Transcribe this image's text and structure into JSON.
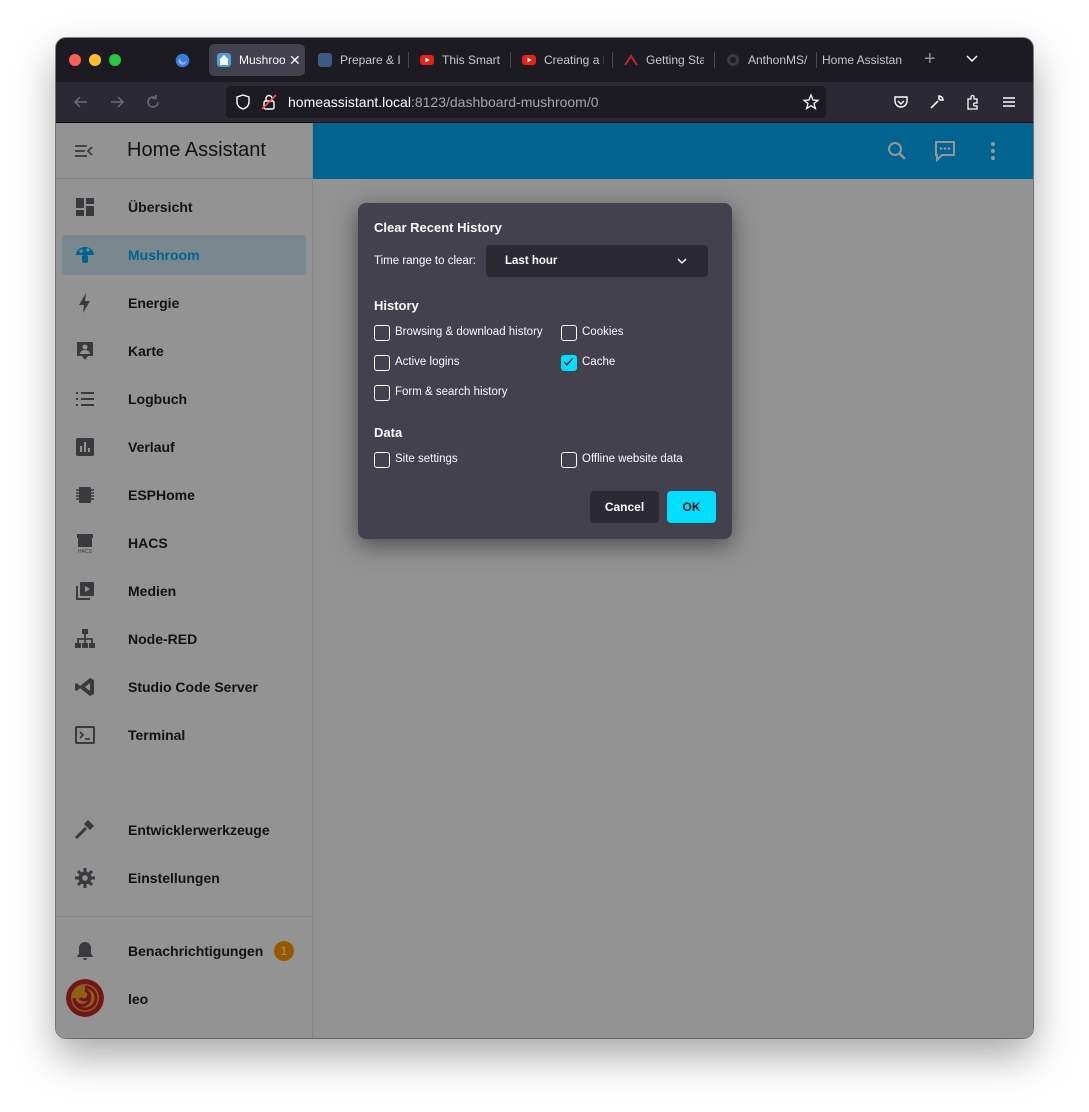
{
  "browser": {
    "tabs": [
      {
        "label": "Mushroo",
        "active": true,
        "favicon": "home-assistant-icon",
        "color": "#49a1d8"
      },
      {
        "label": "Prepare & I",
        "active": false,
        "favicon": "blue-square-icon",
        "color": "#3b5b85"
      },
      {
        "label": "This Smart",
        "active": false,
        "favicon": "youtube-icon",
        "color": "#e62117"
      },
      {
        "label": "Creating a I",
        "active": false,
        "favicon": "youtube-icon",
        "color": "#e62117"
      },
      {
        "label": "Getting Sta",
        "active": false,
        "favicon": "red-logo-icon",
        "color": "#c0262e"
      },
      {
        "label": "AnthonMS/",
        "active": false,
        "favicon": "github-icon",
        "color": "#3a3a3a"
      },
      {
        "label": "Home Assistan",
        "active": false,
        "favicon": "",
        "color": ""
      }
    ],
    "url": {
      "host": "homeassistant.local",
      "rest": ":8123/dashboard-mushroom/0"
    }
  },
  "app": {
    "title": "Home Assistant",
    "accent": "#03a9f4",
    "sidebar": {
      "items": [
        {
          "label": "Übersicht",
          "icon": "dashboard-icon"
        },
        {
          "label": "Mushroom",
          "icon": "mushroom-icon",
          "selected": true
        },
        {
          "label": "Energie",
          "icon": "lightning-icon"
        },
        {
          "label": "Karte",
          "icon": "map-person-icon"
        },
        {
          "label": "Logbuch",
          "icon": "list-icon"
        },
        {
          "label": "Verlauf",
          "icon": "chart-icon"
        },
        {
          "label": "ESPHome",
          "icon": "chip-icon"
        },
        {
          "label": "HACS",
          "icon": "hacs-icon"
        },
        {
          "label": "Medien",
          "icon": "media-icon"
        },
        {
          "label": "Node-RED",
          "icon": "sitemap-icon"
        },
        {
          "label": "Studio Code Server",
          "icon": "vscode-icon"
        },
        {
          "label": "Terminal",
          "icon": "terminal-icon"
        }
      ],
      "bottom_items": [
        {
          "label": "Entwicklerwerkzeuge",
          "icon": "hammer-icon"
        },
        {
          "label": "Einstellungen",
          "icon": "gear-icon"
        }
      ],
      "notifications": {
        "label": "Benachrichtigungen",
        "badge": "1"
      },
      "user": {
        "label": "leo"
      }
    }
  },
  "dialog": {
    "title": "Clear Recent History",
    "range_label": "Time range to clear:",
    "range_value": "Last hour",
    "history_heading": "History",
    "history_options": [
      {
        "label": "Browsing & download history",
        "checked": false
      },
      {
        "label": "Cookies",
        "checked": false
      },
      {
        "label": "Active logins",
        "checked": false
      },
      {
        "label": "Cache",
        "checked": true
      },
      {
        "label": "Form & search history",
        "checked": false
      }
    ],
    "data_heading": "Data",
    "data_options": [
      {
        "label": "Site settings",
        "checked": false
      },
      {
        "label": "Offline website data",
        "checked": false
      }
    ],
    "cancel_label": "Cancel",
    "ok_label": "OK",
    "accent": "#00ddff"
  }
}
